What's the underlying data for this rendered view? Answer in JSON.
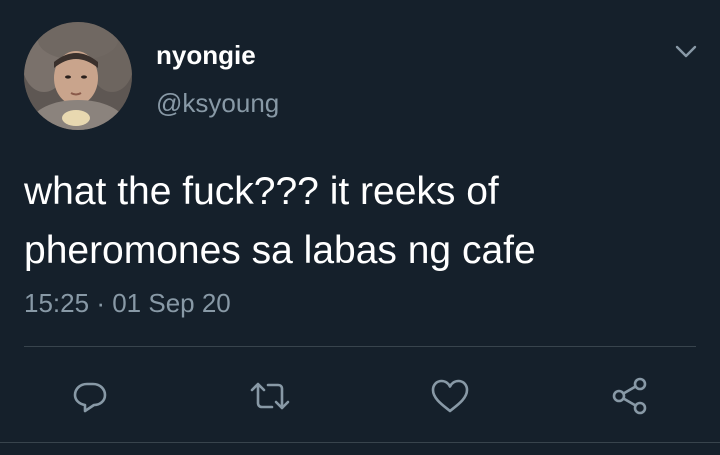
{
  "tweet": {
    "display_name": "nyongie",
    "handle": "@ksyoung",
    "text_lines": [
      "what the fuck??? it reeks of",
      "pheromones sa labas ng cafe"
    ],
    "time": "15:25",
    "separator": "·",
    "date": "01 Sep 20"
  },
  "icons": {
    "menu": "chevron-down-icon",
    "reply": "reply-icon",
    "retweet": "retweet-icon",
    "like": "like-icon",
    "share": "share-icon"
  },
  "colors": {
    "background": "#15202b",
    "primary_text": "#ffffff",
    "secondary_text": "#8899a6",
    "divider": "#38444d"
  }
}
